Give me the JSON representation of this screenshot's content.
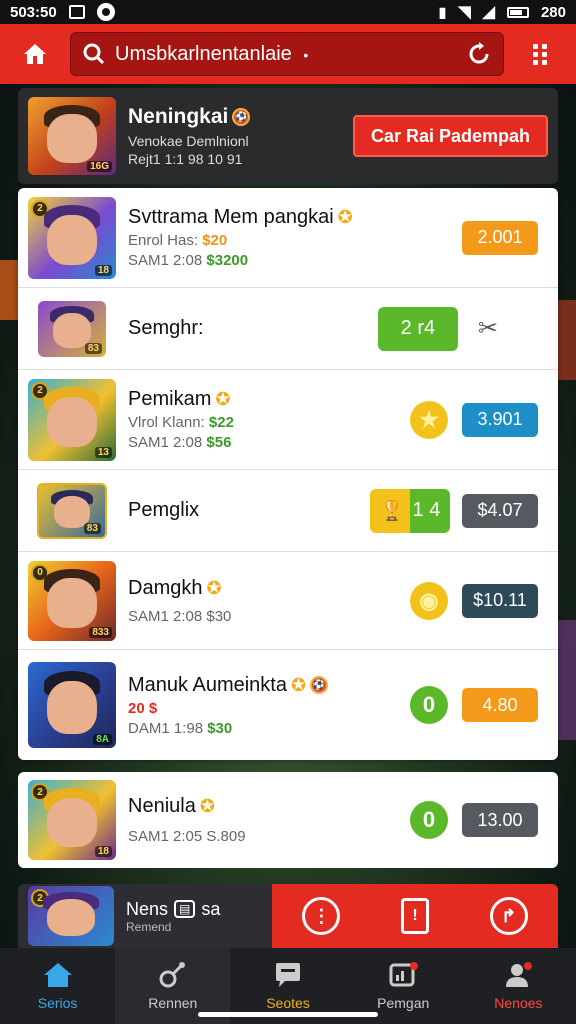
{
  "status_bar": {
    "time": "503:50",
    "right_text": "280"
  },
  "header": {
    "search_text": "Umsbkarlnentanlaie",
    "dropdown_mark": "•"
  },
  "featured": {
    "name": "Neningkai",
    "line1": "Venokae Demlnionl",
    "line2": "Rejt1 1:1 98 10 91",
    "avatar_badge": "16G",
    "cta_label": "Car Rai Padempah"
  },
  "rows": [
    {
      "name": "Svttrama Mem pangkai",
      "line1_label": "Enrol Has:",
      "line1_amount": "$20",
      "line2": "SAM1 2:08",
      "line2_amount": "$3200",
      "badge": "18",
      "price": "2.001"
    },
    {
      "name": "Semghr:",
      "badge": "83",
      "pill_label": "2 r4",
      "extra_icon": "✂"
    },
    {
      "name": "Pemikam",
      "line1_label": "Vlrol Klann:",
      "line1_amount": "$22",
      "line2": "SAM1 2:08",
      "line2_amount": "$56",
      "badge": "13",
      "price": "3.901"
    },
    {
      "name": "Pemglix",
      "badge": "83",
      "pill_label": "1 4",
      "price": "$4.07"
    },
    {
      "name": "Damgkh",
      "line2": "SAM1 2:08 $30",
      "badge": "833",
      "price": "$10.11"
    },
    {
      "name": "Manuk Aumeinkta",
      "line1_amount": "20 $",
      "line2": "DAM1 1:98",
      "line2_amount": "$30",
      "badge": "8A",
      "coin": "0",
      "price": "4.80"
    }
  ],
  "card_row": {
    "name": "Neniula",
    "line2": "SAM1 2:05 S.809",
    "badge": "18",
    "coin": "0",
    "price": "13.00"
  },
  "action_bar": {
    "name": "Nens",
    "name2": "sa",
    "sub": "Remend"
  },
  "bottom_nav": [
    {
      "label": "Serios"
    },
    {
      "label": "Rennen"
    },
    {
      "label": "Seotes"
    },
    {
      "label": "Pemgan"
    },
    {
      "label": "Nenoes"
    }
  ],
  "colors": {
    "brand_red": "#e32b22",
    "orange": "#f39a1a",
    "blue": "#1e8ec6",
    "green": "#5bb82a",
    "dark": "#2d2d33",
    "gold": "#f2b21a"
  }
}
